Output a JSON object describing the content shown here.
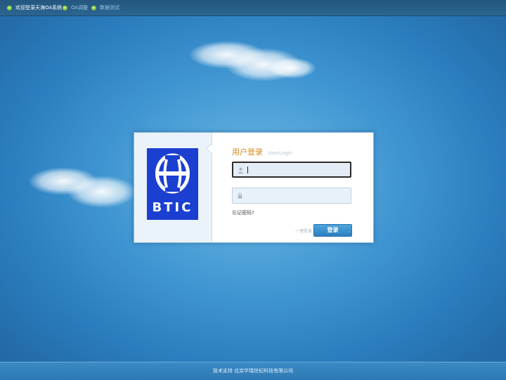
{
  "topbar": {
    "items": [
      {
        "label": "欢迎登录天海OA系统",
        "icon": "play-bullet-icon"
      },
      {
        "label": "OA调整",
        "icon": "play-bullet-icon"
      },
      {
        "label": "数据测试",
        "icon": "play-bullet-icon"
      }
    ]
  },
  "logo": {
    "text": "BTIC",
    "color": "#1a3fd1"
  },
  "login": {
    "title_cn": "用户登录",
    "title_en": "UserLogin",
    "username": {
      "value": "",
      "placeholder": "",
      "icon": "user-icon"
    },
    "password": {
      "value": "",
      "placeholder": "",
      "icon": "lock-icon"
    },
    "forgot_label": "忘记密码?",
    "onekey_label": "一键登录",
    "submit_label": "登录"
  },
  "footer": {
    "text": "技术支持 北京华瑞世纪科技有限公司"
  },
  "colors": {
    "accent": "#2c7ebf",
    "title": "#d58a1e"
  }
}
